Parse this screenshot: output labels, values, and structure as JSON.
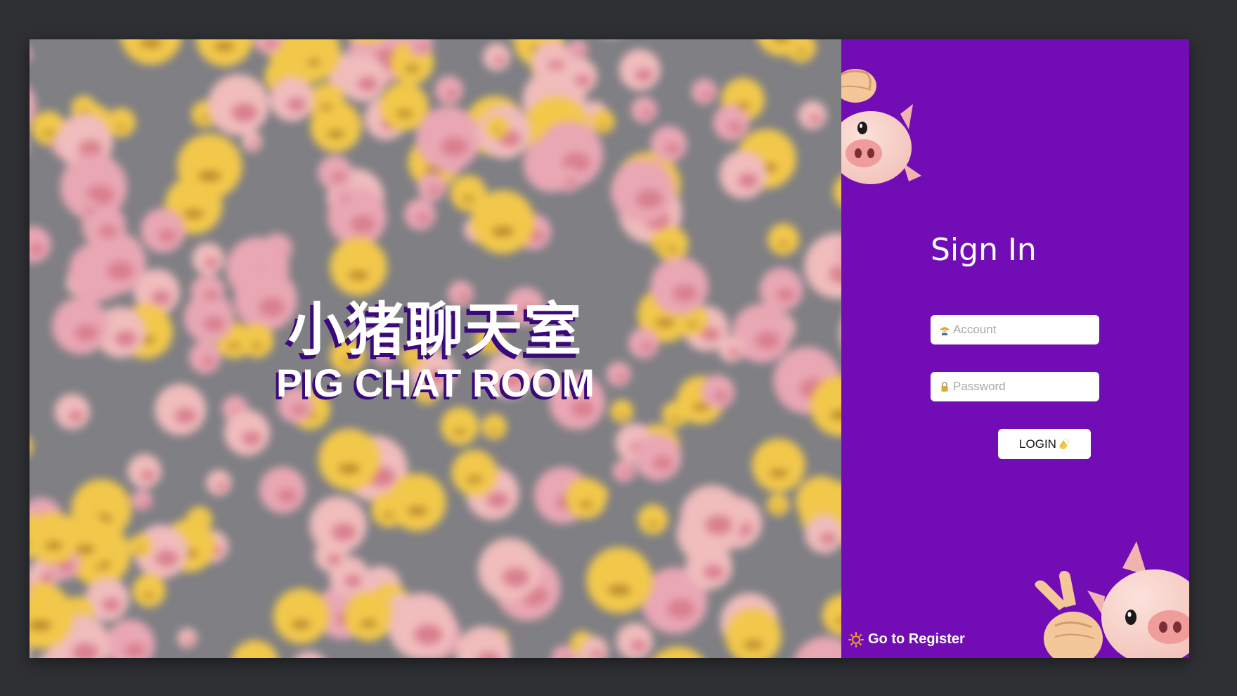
{
  "hero": {
    "title_cn": "小猪聊天室",
    "title_en": "PIG CHAT ROOM"
  },
  "login": {
    "title": "Sign In",
    "account_placeholder": "Account",
    "account_icon": "worker-icon",
    "password_placeholder": "Password",
    "password_icon": "lock-icon",
    "login_label": "LOGIN",
    "login_icon": "clapping-hands-icon",
    "register_label": "Go to Register",
    "register_icon": "sun-icon"
  },
  "colors": {
    "panel_bg": "#720db5",
    "page_bg": "#2f3034",
    "hero_shadow": "#3b0a7a",
    "left_bg": "#7f7f84"
  },
  "decorations": [
    "pig-emoji-icon",
    "fist-emoji-icon",
    "victory-hand-icon",
    "crying-face-emoji-icon"
  ]
}
